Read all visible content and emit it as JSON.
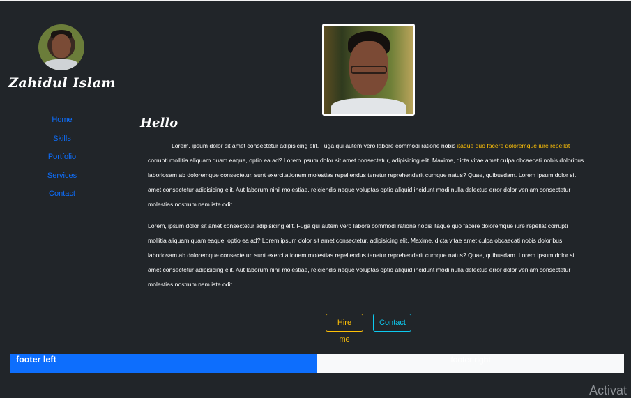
{
  "sidebar": {
    "name": "Zahidul Islam",
    "nav": [
      {
        "label": "Home"
      },
      {
        "label": "Skills"
      },
      {
        "label": "Portfolio"
      },
      {
        "label": "Services"
      },
      {
        "label": "Contact"
      }
    ]
  },
  "main": {
    "heading": "Hello",
    "paragraph1": {
      "before": "Lorem, ipsum dolor sit amet consectetur adipisicing elit. Fuga qui autem vero labore commodi ratione nobis ",
      "highlight": "itaque quo facere doloremque iure repellat",
      "after": " corrupti mollitia aliquam quam eaque, optio ea ad? Lorem ipsum dolor sit amet consectetur, adipisicing elit. Maxime, dicta vitae amet culpa obcaecati nobis doloribus laboriosam ab doloremque consectetur, sunt exercitationem molestias repellendus tenetur reprehenderit cumque natus? Quae, quibusdam. Lorem ipsum dolor sit amet consectetur adipisicing elit. Aut laborum nihil molestiae, reiciendis neque voluptas optio aliquid incidunt modi nulla delectus error dolor veniam consectetur molestias nostrum nam iste odit."
    },
    "paragraph2": "Lorem, ipsum dolor sit amet consectetur adipisicing elit. Fuga qui autem vero labore commodi ratione nobis itaque quo facere doloremque iure repellat corrupti mollitia aliquam quam eaque, optio ea ad? Lorem ipsum dolor sit amet consectetur, adipisicing elit. Maxime, dicta vitae amet culpa obcaecati nobis doloribus laboriosam ab doloremque consectetur, sunt exercitationem molestias repellendus tenetur reprehenderit cumque natus? Quae, quibusdam. Lorem ipsum dolor sit amet consectetur adipisicing elit. Aut laborum nihil molestiae, reiciendis neque voluptas optio aliquid incidunt modi nulla delectus error dolor veniam consectetur molestias nostrum nam iste odit.",
    "buttons": {
      "hire": "Hire me",
      "contact": "Contact"
    }
  },
  "footer": {
    "left": "footer left",
    "right": "footer right"
  },
  "watermark": "Activat",
  "colors": {
    "background": "#212529",
    "link": "#0d6efd",
    "warning": "#ffc107",
    "info": "#0dcaf0",
    "footer_left_bg": "#0d6efd",
    "footer_right_bg": "#f8f9fa"
  }
}
